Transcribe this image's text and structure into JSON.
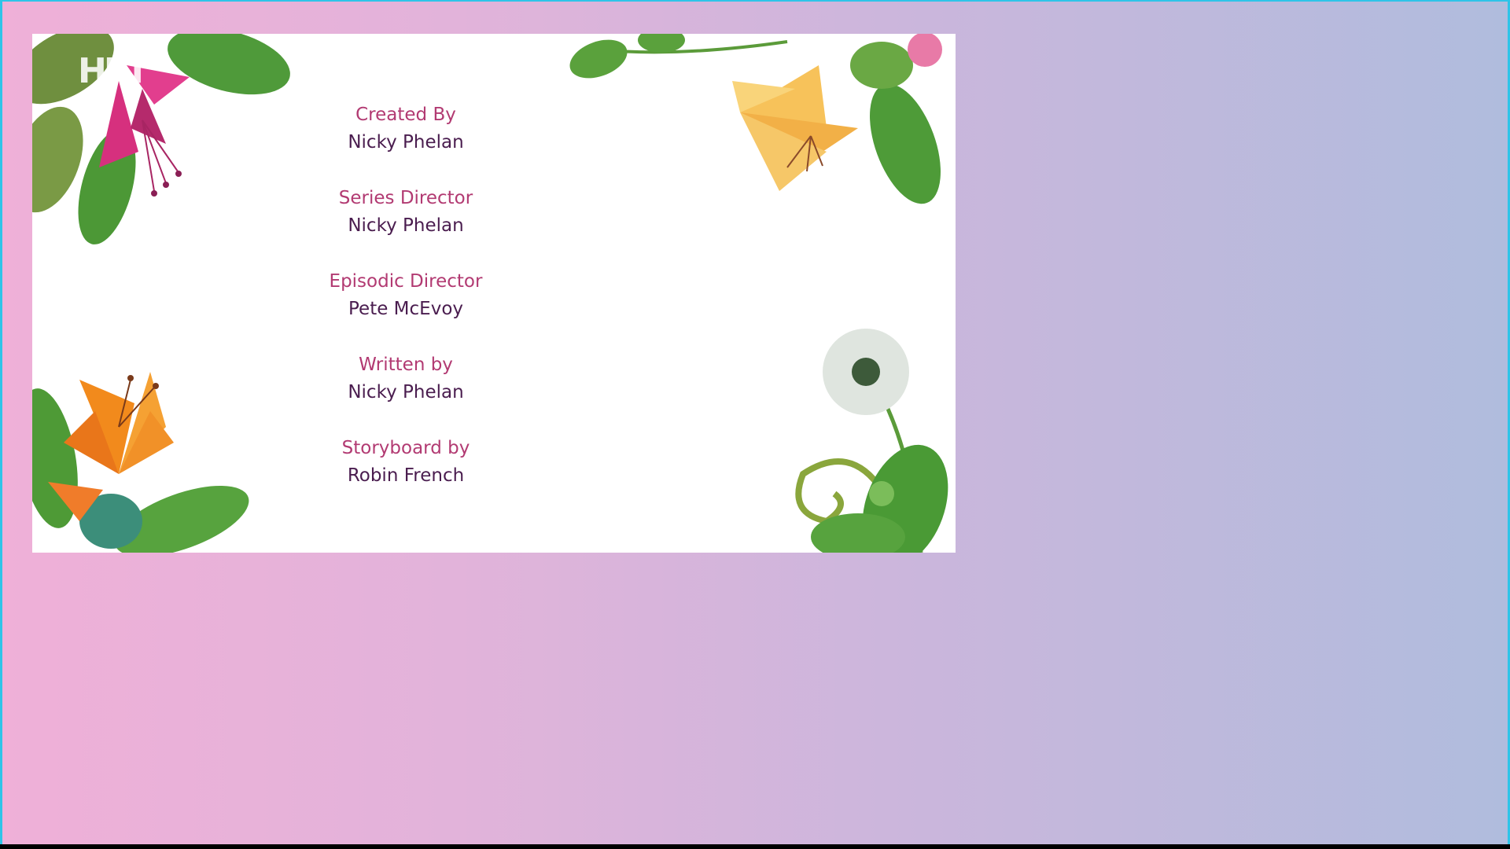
{
  "player": {
    "channel_logo": "HRT"
  },
  "credits": [
    {
      "role": "Created By",
      "name": "Nicky Phelan"
    },
    {
      "role": "Series Director",
      "name": "Nicky Phelan"
    },
    {
      "role": "Episodic Director",
      "name": "Pete McEvoy"
    },
    {
      "role": "Written by",
      "name": "Nicky Phelan"
    },
    {
      "role": "Storyboard by",
      "name": "Robin French"
    }
  ],
  "colors": {
    "role_text": "#b23a72",
    "name_text": "#4a1d4f",
    "background_left": "#efb0d8",
    "background_right": "#b0bcdd",
    "frame_border": "#2ec4e8"
  }
}
